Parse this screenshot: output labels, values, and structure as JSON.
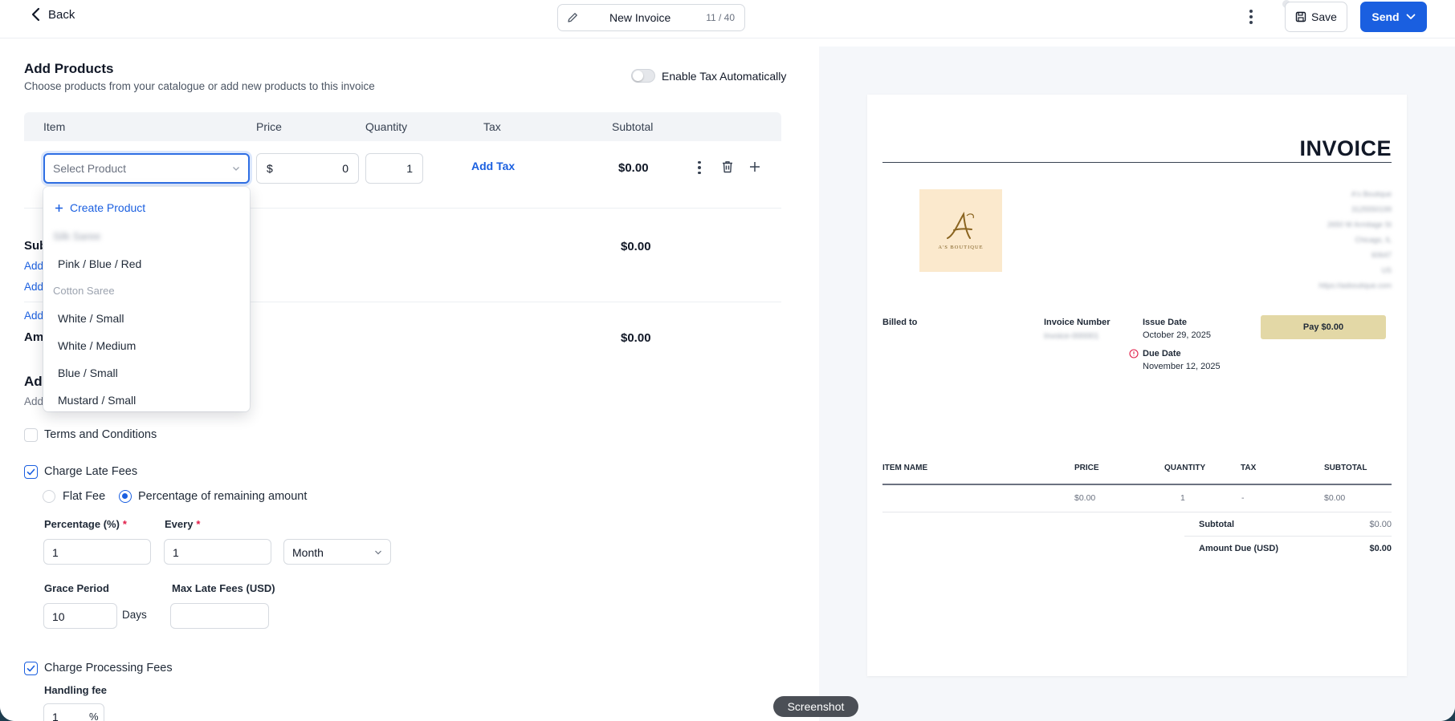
{
  "header": {
    "back_label": "Back",
    "invoice_title": "New Invoice",
    "title_count": "11 / 40",
    "save_label": "Save",
    "send_label": "Send"
  },
  "products": {
    "heading": "Add Products",
    "subheading": "Choose products from your catalogue or add new products to this invoice",
    "tax_toggle_label": "Enable Tax Automatically",
    "columns": [
      "Item",
      "Price",
      "Quantity",
      "Tax",
      "Subtotal"
    ],
    "row": {
      "product_placeholder": "Select Product",
      "currency": "$",
      "price": "0",
      "quantity": "1",
      "add_tax": "Add Tax",
      "subtotal": "$0.00"
    },
    "subtotal_label": "Sub",
    "subtotal_value": "$0.00",
    "add_link_1": "Add",
    "add_link_2": "Add",
    "add_link_3": "Add",
    "amount_label": "Am",
    "amount_value": "$0.00"
  },
  "dropdown": {
    "create_label": "Create Product",
    "group_1": "Silk Saree",
    "items_1": [
      "Pink / Blue / Red"
    ],
    "group_2": "Cotton Saree",
    "items_2": [
      "White / Small",
      "White / Medium",
      "Blue / Small",
      "Mustard / Small"
    ]
  },
  "additional": {
    "heading": "Ad",
    "subheading": "Add",
    "terms_label": "Terms and Conditions",
    "late_fees_label": "Charge Late Fees",
    "flat_fee_label": "Flat Fee",
    "percentage_label": "Percentage of remaining amount",
    "percentage_field_label": "Percentage (%)",
    "percentage_value": "1",
    "every_label": "Every",
    "every_value": "1",
    "period_value": "Month",
    "grace_label": "Grace Period",
    "grace_value": "10",
    "days_label": "Days",
    "max_late_label": "Max Late Fees (USD)",
    "max_late_value": "",
    "processing_label": "Charge Processing Fees",
    "handling_label": "Handling fee",
    "handling_value": "1",
    "percent_sign": "%"
  },
  "preview": {
    "title": "INVOICE",
    "logo_text": "A'S BOUTIQUE",
    "address_lines": [
      "A's Boutique",
      "3125550199",
      "2650 W Armitage St",
      "Chicago, IL",
      "60647",
      "US",
      "https://asboutique.com"
    ],
    "billed_to_label": "Billed to",
    "invoice_number_label": "Invoice Number",
    "invoice_number_value": "Invoice-000001",
    "issue_date_label": "Issue Date",
    "issue_date_value": "October 29, 2025",
    "due_date_label": "Due Date",
    "due_date_value": "November 12, 2025",
    "pay_label": "Pay $0.00",
    "columns": [
      "ITEM NAME",
      "PRICE",
      "QUANTITY",
      "TAX",
      "SUBTOTAL"
    ],
    "row": {
      "price": "$0.00",
      "quantity": "1",
      "tax": "-",
      "subtotal": "$0.00"
    },
    "subtotal_label": "Subtotal",
    "subtotal_value": "$0.00",
    "amount_due_label": "Amount Due (USD)",
    "amount_due_value": "$0.00"
  },
  "tooltip": {
    "screenshot_label": "Screenshot"
  },
  "colors": {
    "accent": "#1a5fe0",
    "pay_button": "#e3d8a6",
    "logo_bg": "#fbe9cd"
  }
}
